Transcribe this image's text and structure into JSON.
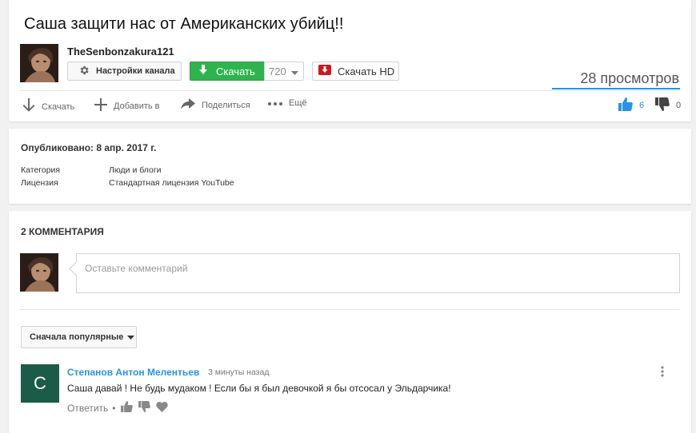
{
  "video": {
    "title": "Саша защити нас от Американских убийц!!",
    "channel_name": "TheSenbonzakura121",
    "settings_label": "Настройки канала",
    "download_label": "Скачать",
    "quality": "720",
    "download_hd_label": "Скачать HD",
    "views": "28 просмотров",
    "actions": {
      "download": "Скачать",
      "add_to": "Добавить в",
      "share": "Поделиться",
      "more": "Ещё"
    },
    "likes": "6",
    "dislikes": "0"
  },
  "info": {
    "published": "Опубликовано: 8 апр. 2017 г.",
    "category_label": "Категория",
    "category_value": "Люди и блоги",
    "license_label": "Лицензия",
    "license_value": "Стандартная лицензия YouTube"
  },
  "comments": {
    "count_label": "2 КОММЕНТАРИЯ",
    "input_placeholder": "Оставьте комментарий",
    "sort_label": "Сначала популярные",
    "items": [
      {
        "avatar_letter": "С",
        "author": "Степанов Антон Мелентьев",
        "time": "3 минуты назад",
        "text": "Саша давай ! Не будь мудаком ! Если бы я был девочкой я бы отсосал у Эльдарчика!",
        "reply_label": "Ответить"
      }
    ]
  },
  "colors": {
    "accent": "#2793e6",
    "download_green": "#2eb34f",
    "hd_red": "#cc181e",
    "comment_avatar": "#1a5c47"
  },
  "icons": [
    "gear-icon",
    "download-arrow-icon",
    "chevron-down-icon",
    "hd-download-icon",
    "add-icon",
    "share-icon",
    "more-icon",
    "thumbs-up-icon",
    "thumbs-down-icon",
    "heart-icon",
    "kebab-menu-icon"
  ]
}
